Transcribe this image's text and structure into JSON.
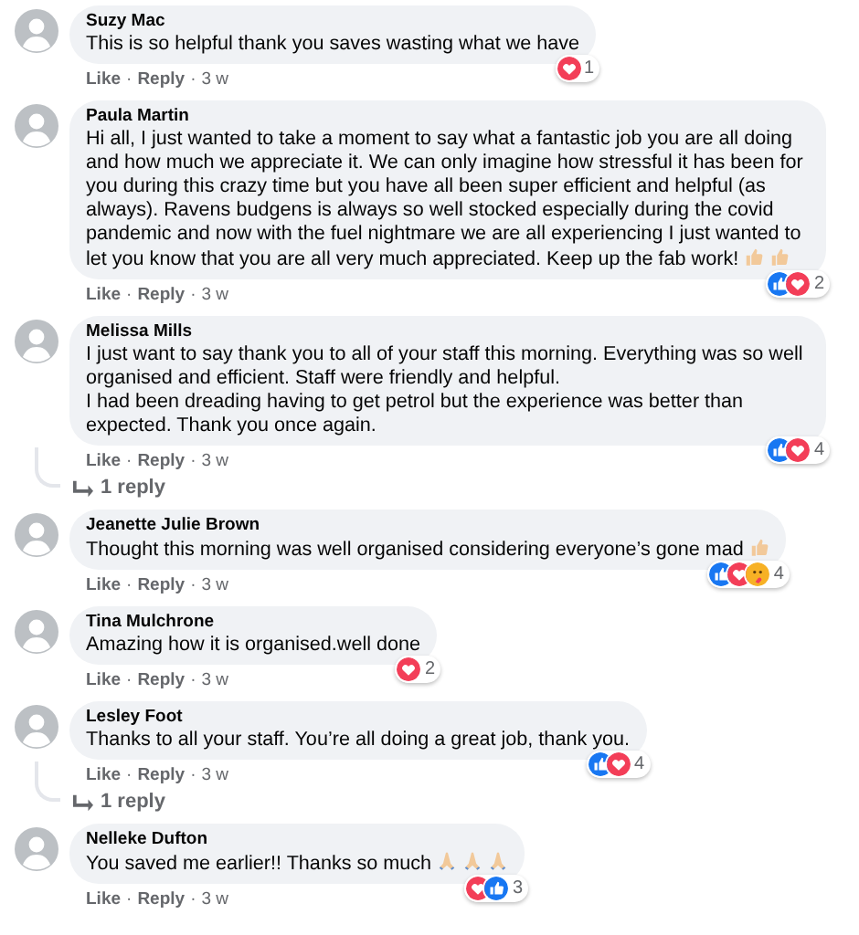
{
  "separator": "·",
  "comments": [
    {
      "author": "Suzy Mac",
      "text": "This is so helpful thank you saves wasting what we have",
      "reactions": [
        {
          "kind": "love"
        }
      ],
      "reaction_count": "1",
      "actions": [
        "Like",
        "Reply"
      ],
      "time": "3 w"
    },
    {
      "author": "Paula Martin",
      "text": "Hi all, I just wanted to take a moment to say what a fantastic job you are all doing and how much we appreciate it. We can only imagine how stressful it has been for you during this crazy time but you have all been super efficient and helpful (as always). Ravens budgens is always so well stocked especially during the covid pandemic and now with the fuel nightmare we are all experiencing I just wanted to let you know that you are all very much appreciated. Keep up the fab work!",
      "emojis": [
        {
          "kind": "thumbs-up"
        },
        {
          "kind": "thumbs-up"
        }
      ],
      "reactions": [
        {
          "kind": "like"
        },
        {
          "kind": "love"
        }
      ],
      "reaction_count": "2",
      "actions": [
        "Like",
        "Reply"
      ],
      "time": "3 w"
    },
    {
      "author": "Melissa Mills",
      "text": "I just want to say thank you to all of your staff this morning. Everything was so well organised and efficient. Staff were friendly and helpful.\nI had been dreading having to get petrol but the experience was better than expected. Thank you once again.",
      "reactions": [
        {
          "kind": "like"
        },
        {
          "kind": "love"
        }
      ],
      "reaction_count": "4",
      "actions": [
        "Like",
        "Reply"
      ],
      "time": "3 w",
      "replies_link": "1 reply"
    },
    {
      "author": "Jeanette Julie Brown",
      "text": "Thought this morning was well organised considering everyone’s gone mad",
      "emojis": [
        {
          "kind": "thumbs-up"
        }
      ],
      "reactions": [
        {
          "kind": "like"
        },
        {
          "kind": "love"
        },
        {
          "kind": "care"
        }
      ],
      "reaction_count": "4",
      "actions": [
        "Like",
        "Reply"
      ],
      "time": "3 w"
    },
    {
      "author": "Tina Mulchrone",
      "text": "Amazing how it is organised.well done",
      "reactions": [
        {
          "kind": "love"
        }
      ],
      "reaction_count": "2",
      "actions": [
        "Like",
        "Reply"
      ],
      "time": "3 w"
    },
    {
      "author": "Lesley Foot",
      "text": "Thanks to all your staff. You’re all doing a great job, thank you.",
      "reactions": [
        {
          "kind": "like"
        },
        {
          "kind": "love"
        }
      ],
      "reaction_count": "4",
      "actions": [
        "Like",
        "Reply"
      ],
      "time": "3 w",
      "replies_link": "1 reply"
    },
    {
      "author": "Nelleke Dufton",
      "text": "You saved me earlier!! Thanks so much",
      "emojis": [
        {
          "kind": "praying-hands"
        },
        {
          "kind": "praying-hands"
        },
        {
          "kind": "praying-hands"
        }
      ],
      "reactions": [
        {
          "kind": "love"
        },
        {
          "kind": "like"
        }
      ],
      "reaction_count": "3",
      "actions": [
        "Like",
        "Reply"
      ],
      "time": "3 w"
    }
  ]
}
